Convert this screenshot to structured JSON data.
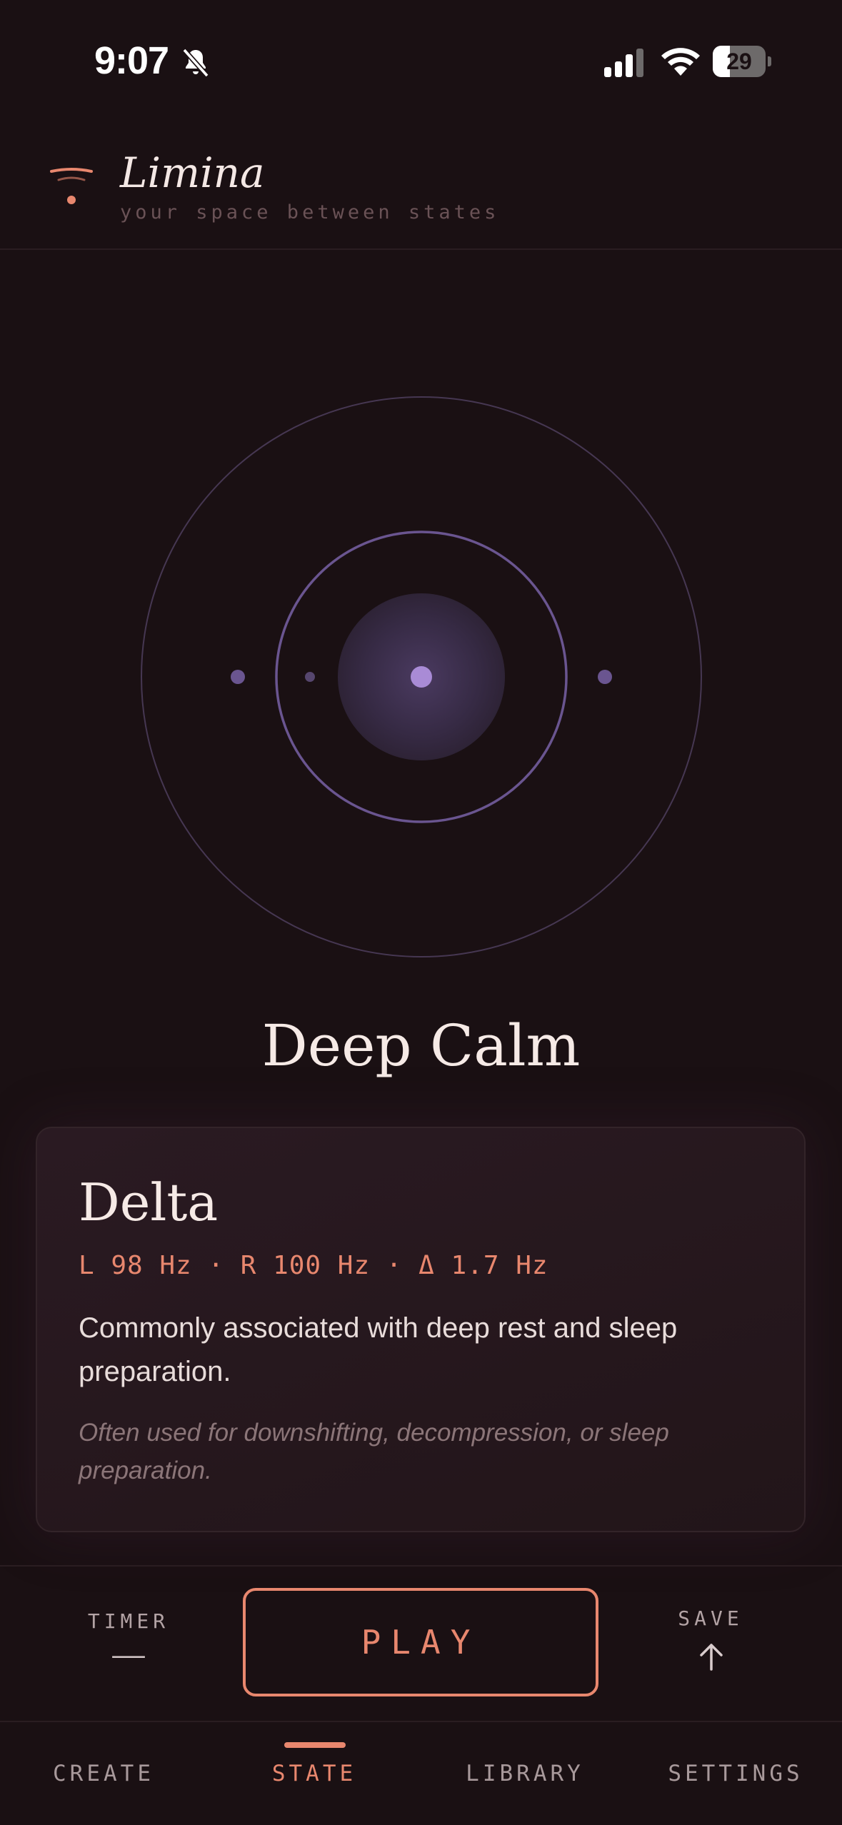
{
  "status_bar": {
    "time": "9:07",
    "battery": "29"
  },
  "header": {
    "app_name": "Limina",
    "tagline": "your space between states"
  },
  "state": {
    "title": "Deep Calm"
  },
  "card": {
    "band": "Delta",
    "frequencies": "L 98 Hz · R 100 Hz · Δ 1.7 Hz",
    "description": "Commonly associated with deep rest and sleep preparation.",
    "note": "Often used for downshifting, decompression, or sleep preparation."
  },
  "controls": {
    "timer_label": "TIMER",
    "timer_value": "——",
    "play_label": "PLAY",
    "save_label": "SAVE"
  },
  "tabs": [
    {
      "label": "CREATE",
      "active": false
    },
    {
      "label": "STATE",
      "active": true
    },
    {
      "label": "LIBRARY",
      "active": false
    },
    {
      "label": "SETTINGS",
      "active": false
    }
  ],
  "colors": {
    "background": "#1a1013",
    "accent": "#e8876e",
    "orb": "#a98bd6",
    "ring": "#6a5590"
  }
}
